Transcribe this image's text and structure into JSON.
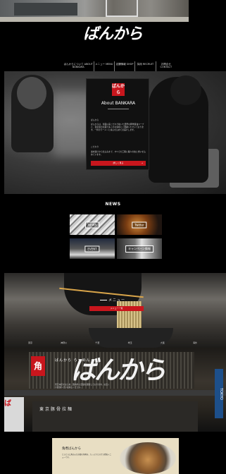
{
  "header": {
    "logo_text": "ばんから",
    "nav": [
      "ばんからについて ABOUT BANKARA",
      "メニュー MENU",
      "店舗情報 SHOP",
      "採用 RECRUIT",
      "お問合せ CONTACT"
    ]
  },
  "about": {
    "badge": "ばんから",
    "title": "About BANKARA",
    "lead_heading": "ばんから",
    "lead_text": "ばんからは、創業以来こだわり抜いた濃厚な豚骨醤油スープと、自家製の太麺で多くのお客様にご愛顧いただいております。一杯のラーメンに真心を込めてお届けします。",
    "sub_heading": "こだわり",
    "sub_text": "素材選びから仕込みまで、すべての工程に職人の技と想いを込めています。",
    "button": "詳しく見る"
  },
  "news": {
    "title": "NEWS",
    "items": [
      {
        "label": "NEWS"
      },
      {
        "label": "Twitter"
      },
      {
        "label": "EVENT"
      },
      {
        "label": "キャンペーン情報"
      }
    ]
  },
  "menu": {
    "label": "メニュー",
    "button": "メニュー一覧"
  },
  "shop": {
    "tabs": [
      "東京",
      "神奈川",
      "千葉",
      "埼玉",
      "大阪",
      "海外"
    ],
    "heading": "ばんから らーめん",
    "text": "東京本店をはじめ、国内外に店舗を展開しております。お近くの店舗へぜひお越しください。",
    "sign": "ばんから",
    "red_sign": "角",
    "lower_sign": "東京豚骨拉麺",
    "tokyo_sign": "TOKYO",
    "left_sign": "ば"
  },
  "recipe": {
    "heading": "角煮ばんから",
    "text": "とろとろに煮込んだ自慢の角煮を、たっぷりとのせた看板メニューです。"
  }
}
